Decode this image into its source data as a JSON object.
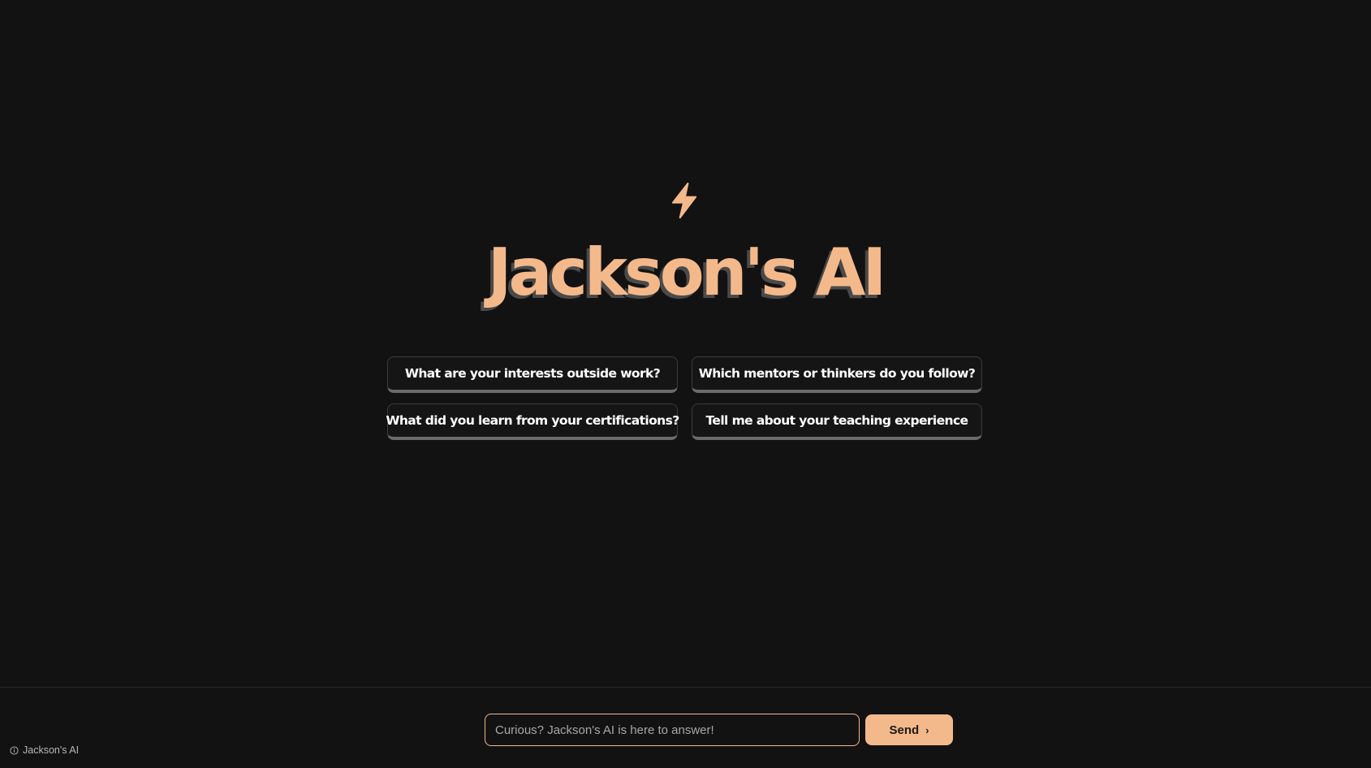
{
  "hero": {
    "icon": "lightning-bolt-icon",
    "title": "Jackson's AI"
  },
  "suggestions": [
    "What are your interests outside work?",
    "Which mentors or thinkers do you follow?",
    "What did you learn from your certifications?",
    "Tell me about your teaching experience"
  ],
  "composer": {
    "placeholder": "Curious? Jackson's AI is here to answer!",
    "value": "",
    "send_label": "Send",
    "send_icon": "chevron-right-icon"
  },
  "footer": {
    "brand_label": "Jackson's AI",
    "brand_icon": "info-icon"
  },
  "colors": {
    "background": "#121212",
    "accent": "#f4b98b",
    "title_shadow": "#4a4a4a",
    "suggestion_border": "#3c3c3c"
  }
}
